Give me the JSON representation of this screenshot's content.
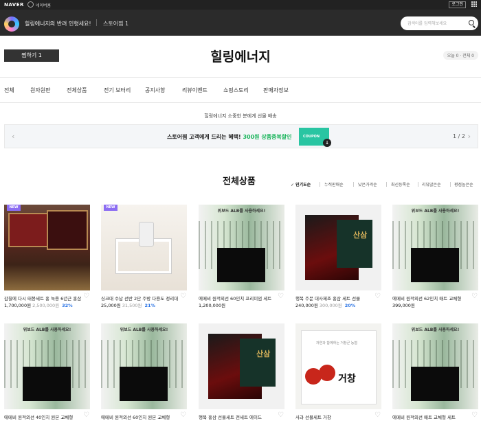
{
  "topbar": {
    "brand": "NAVER",
    "home_label": "네이버홈",
    "login": "로그인"
  },
  "store": {
    "name": "힐링에너지의 반려 인형세요!",
    "follow": "스토어찜 1",
    "search_placeholder": "검색어를 입력해보세요"
  },
  "header": {
    "zzim_button": "찜하기 1",
    "title": "힐링에너지",
    "visits": "오늘 0 · 전체 0"
  },
  "nav": [
    "전체",
    "원자원판",
    "전체상품",
    "전기 보터리",
    "공지사항",
    "리뷰이벤트",
    "쇼핑스토리",
    "판매자정보"
  ],
  "notice": "힐링에너지 소중한 분에게 선물 배송",
  "banner": {
    "text_prefix": "스토어찜 고객에게 드리는 혜택!",
    "text_highlight": "300원 상품중복할인",
    "coupon": "COUPON",
    "page": "1 / 2"
  },
  "section_title": "전체상품",
  "sort": [
    "인기도순",
    "누적판매순",
    "낮은가격순",
    "최신등록순",
    "리뷰많은순",
    "평점높은순"
  ],
  "products": [
    {
      "title": "감칠에 다시 태봉세트 홍 녹용 6년근 홍삼",
      "price": "1,700,000원",
      "orig": "2,500,000원",
      "disc": "32%",
      "badge": "NEW"
    },
    {
      "title": "싱크대 수납 선반 2단 주방 다용도 정리대 선반",
      "price": "25,000원",
      "orig": "31,500원",
      "disc": "21%",
      "badge": "NEW"
    },
    {
      "title": "에메비 원적외선 60인치 프리미엄 세트",
      "price": "1,200,000원",
      "orig": "",
      "disc": "",
      "badge": "",
      "caption": "위보드 ALB를 사용하세요!"
    },
    {
      "title": "행복 주문 대사제조 홍삼 세트 선물",
      "price": "240,000원",
      "orig": "300,000원",
      "disc": "20%",
      "badge": ""
    },
    {
      "title": "에메비 원적외선 62인치 매트 교체형",
      "price": "399,000원",
      "orig": "",
      "disc": "",
      "badge": "",
      "caption": "위보드 ALB를 사용하세요!"
    },
    {
      "title": "에메비 원적외선 40인치 원본 교체형",
      "price": "",
      "orig": "",
      "disc": "",
      "badge": "",
      "caption": "위보드 ALB를 사용하세요!"
    },
    {
      "title": "에메비 원적외선 60인치 원본 교체형",
      "price": "",
      "orig": "",
      "disc": "",
      "badge": "",
      "caption": "위보드 ALB를 사용하세요!"
    },
    {
      "title": "행복 홍삼 선물세트 전세트 에이드",
      "price": "",
      "orig": "",
      "disc": "",
      "badge": ""
    },
    {
      "title": "사과 선물세트 거창",
      "price": "",
      "orig": "",
      "disc": "",
      "badge": "",
      "box_label": "거창",
      "box_top": "자연과 함께하는 거창군 농협"
    },
    {
      "title": "에메비 원적외선 매트 교체형 세트",
      "price": "",
      "orig": "",
      "disc": "",
      "badge": "",
      "caption": "위보드 ALB를 사용하세요!"
    }
  ]
}
